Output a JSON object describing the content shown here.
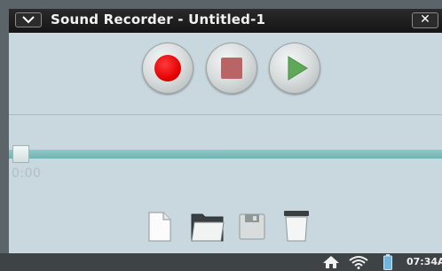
{
  "window": {
    "title": "Sound Recorder - Untitled-1",
    "close_label": "✕"
  },
  "transport": {
    "buttons": [
      "record",
      "stop",
      "play"
    ]
  },
  "track": {
    "time": "0:00",
    "position_fraction": 0
  },
  "file_toolbar": {
    "icons": [
      "new-file-icon",
      "open-folder-icon",
      "save-disk-icon",
      "delete-trash-icon"
    ]
  },
  "taskbar": {
    "clock": "07:34A"
  },
  "colors": {
    "window_bg": "#c9d8de",
    "titlebar_bg": "#1c1c1c",
    "record_red": "#e20000",
    "stop_red": "#b96565",
    "play_green": "#5ea85a",
    "track_teal": "#7cbcbc",
    "taskbar_bg": "#3e4346"
  }
}
